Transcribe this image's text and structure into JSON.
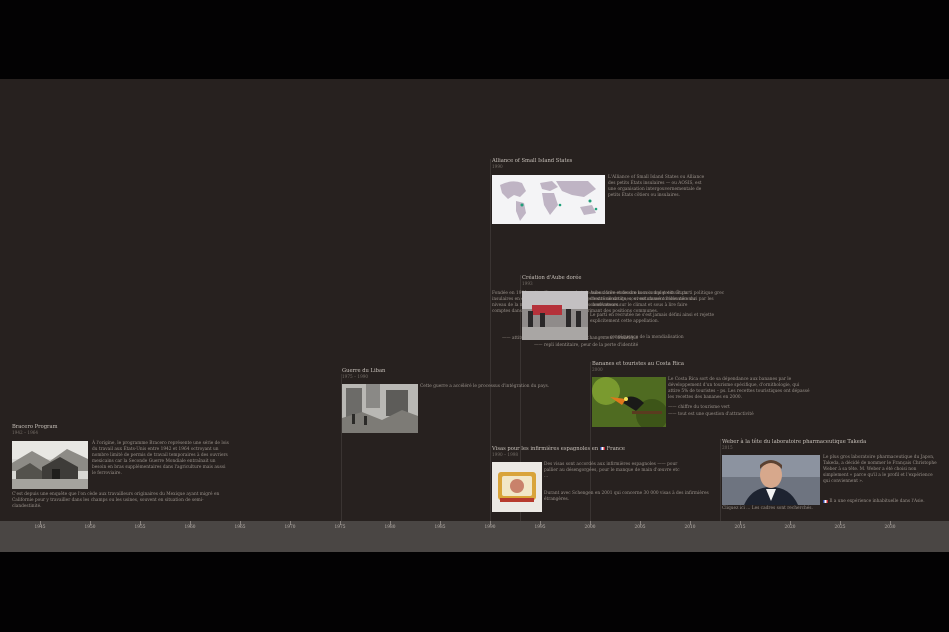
{
  "events": [
    {
      "id": "bracero",
      "title": "Bracero Program",
      "date": "1942 – 1964",
      "text": "À l'origine, le programme Bracero représente une série de lois du travail aux États-Unis entre 1942 et 1964 octroyant un nombre limité de permis de travail temporaires à des ouvriers mexicains car la Seconde Guerre Mondiale entraînait un besoin en bras supplémentaires dans l'agriculture mais aussi le ferroviaire.",
      "text2": "C'est depuis une enquête que l'on cède aux travailleurs originaires du Mexique ayant migré en Californie pour y travailler dans les champs ou les usines, souvent en situation de semi-clandestinité."
    },
    {
      "id": "liban",
      "title": "Guerre du Liban",
      "date": "1975 – 1990",
      "text": "Cette guerre a accéléré le processus d'intégration du pays."
    },
    {
      "id": "aosis",
      "title": "Alliance of Small Island States",
      "date": "1990",
      "text": "L'Alliance of Small Island States ou Alliance des petits États insulaires — ou AOSIS, est une organisation intergouvernementale de petits États côtiers ou insulaires.",
      "text2": "Fondée en 1990, cette alliance a pour but de mieux faire entendre la voix des petits États insulaires en développement face aux changements climatiques, et notamment l'élévation du niveau de la mer. Elle les représente lors des conférences sur le climat et sous à lire faire comptes dans le débat international, en exprimant des positions communes.",
      "text3": "—— attitude gouvernementale face au changement climatique"
    },
    {
      "id": "aube",
      "title": "Création d'Aube dorée",
      "date": "1993",
      "text": "Aube dorée et de son nom complet est un parti politique grec d'extrême droite, souvent classé comme néo-nazi par les observateurs.",
      "text2": "Le parti en recrutée ne s'est jamais défini ainsi et rejette explicitement cette appellation.",
      "text3": "—— conséquence de la mondialisation",
      "text4": "—— repli identitaire, peur de la perte d'identité"
    },
    {
      "id": "visas",
      "title": "Visas pour les infirmières espagnoles en",
      "country": "France",
      "date": "1990 – 1998",
      "text": "Des visas sont accordés aux infirmières espagnoles —— pour pallier au désengorgées, pour le manque de main d'œuvre etc ...",
      "text2": "Durant avec Schengen en 2001 qui concerne 30 000 visas à des infirmières étrangères."
    },
    {
      "id": "bananes",
      "title": "Bananes et touristes au Costa Rica",
      "date": "2000",
      "text": "Le Costa Rica sort de sa dépendance aux bananes par le développement d'un tourisme spécifique, d'ornithologie, qui attire 5% de touristes – ps. Les recettes touristiques ont dépassé les recettes des bananes en 2000.",
      "text2": "—— chiffre du tourisme vert",
      "text3": "—— tout est une question d'attractivité"
    },
    {
      "id": "weber",
      "title": "Weber à la tête du laboratoire pharmaceutique Takeda",
      "date": "2015",
      "text": "Le plus gros laboratoire pharmaceutique du Japon, Takeda, a décidé de nommer le Français Christophe Weber à sa tête. M. Weber a été choisi non simplement « parce qu'il a le profil et l'expérience qui conviennent ».",
      "text2": "Cliquez ici ... Les cadres sont recherchés.",
      "text3": "Il a une expérience inhabituelle dans l'Asie."
    }
  ],
  "axis_years": [
    "1945",
    "1950",
    "1955",
    "1960",
    "1965",
    "1970",
    "1975",
    "1980",
    "1985",
    "1990",
    "1995",
    "2000",
    "2005",
    "2010",
    "2015",
    "2020",
    "2025",
    "2030"
  ],
  "colors": {
    "stage_background": "#27211f",
    "axis_background": "#4a4644",
    "letterbox": "#030203"
  }
}
